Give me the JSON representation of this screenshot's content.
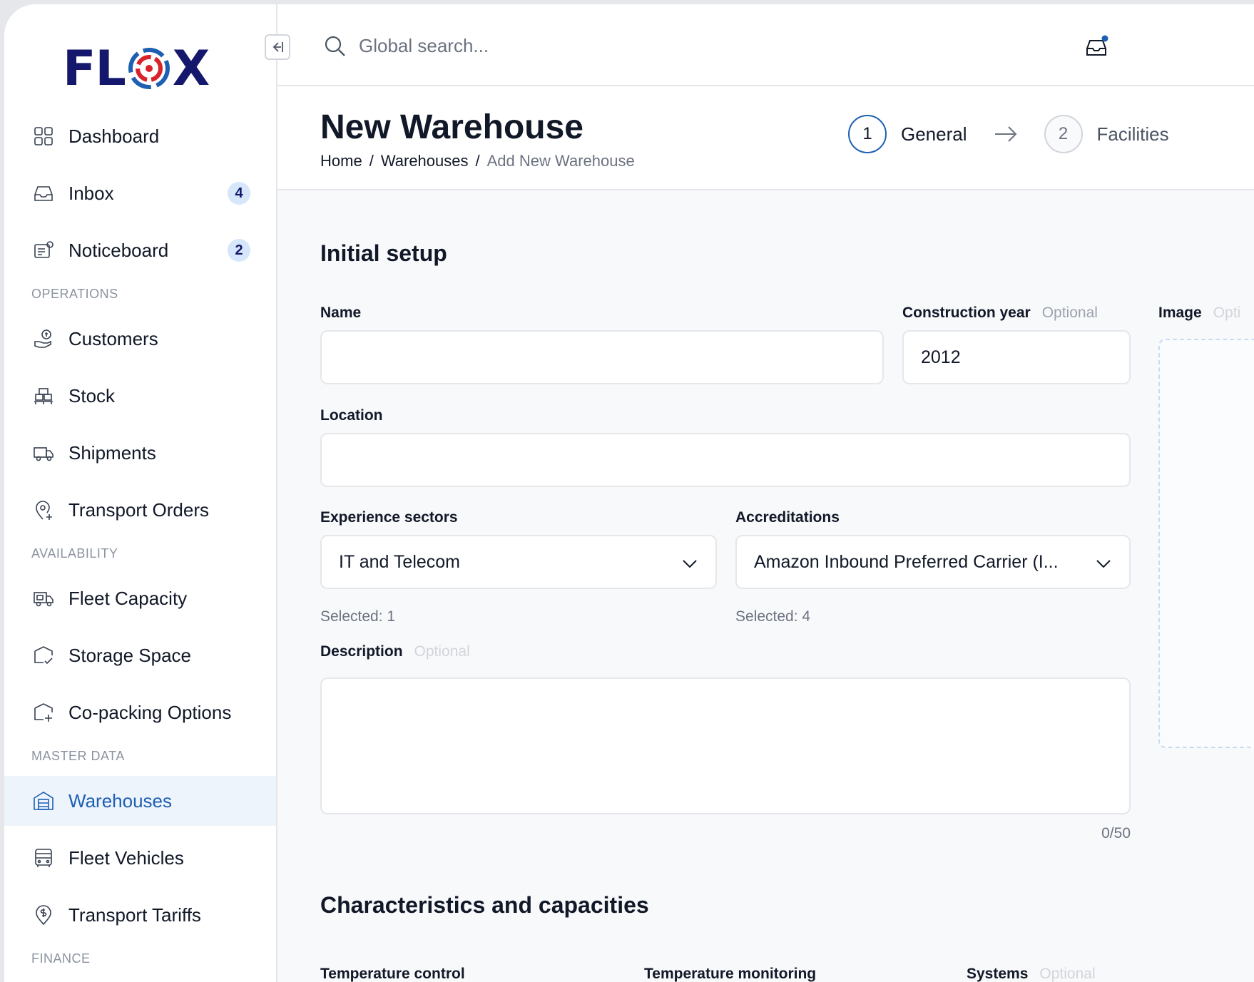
{
  "brand": {
    "logo_text_left": "FL",
    "logo_text_right": "X",
    "accent": "#1d5fb3",
    "navy": "#14176b",
    "logo_ring": "#d8232a"
  },
  "sidebar": {
    "items": [
      {
        "label": "Dashboard",
        "icon": "grid-icon"
      },
      {
        "label": "Inbox",
        "icon": "inbox-icon",
        "badge": "4"
      },
      {
        "label": "Noticeboard",
        "icon": "noticeboard-icon",
        "badge": "2"
      }
    ],
    "sections": [
      {
        "title": "OPERATIONS",
        "items": [
          {
            "label": "Customers",
            "icon": "hand-coin-icon"
          },
          {
            "label": "Stock",
            "icon": "pallet-icon"
          },
          {
            "label": "Shipments",
            "icon": "truck-icon"
          },
          {
            "label": "Transport Orders",
            "icon": "location-pin-plus-icon"
          }
        ]
      },
      {
        "title": "AVAILABILITY",
        "items": [
          {
            "label": "Fleet Capacity",
            "icon": "truck-box-icon"
          },
          {
            "label": "Storage Space",
            "icon": "box-check-icon"
          },
          {
            "label": "Co-packing Options",
            "icon": "box-plus-icon"
          }
        ]
      },
      {
        "title": "MASTER DATA",
        "items": [
          {
            "label": "Warehouses",
            "icon": "warehouse-icon",
            "active": true
          },
          {
            "label": "Fleet Vehicles",
            "icon": "bus-icon"
          },
          {
            "label": "Transport Tariffs",
            "icon": "location-dollar-icon"
          }
        ]
      },
      {
        "title": "FINANCE",
        "items": []
      }
    ]
  },
  "topbar": {
    "search_placeholder": "Global search..."
  },
  "header": {
    "title": "New Warehouse",
    "breadcrumb": [
      "Home",
      "/",
      "Warehouses",
      "/",
      "Add New Warehouse"
    ],
    "steps": [
      {
        "number": "1",
        "label": "General",
        "active": true
      },
      {
        "number": "2",
        "label": "Facilities",
        "active": false
      }
    ]
  },
  "form": {
    "initial_setup_title": "Initial setup",
    "name_label": "Name",
    "name_value": "",
    "construction_label": "Construction year",
    "construction_optional": "Optional",
    "construction_value": "2012",
    "image_label": "Image",
    "image_optional": "Opti",
    "location_label": "Location",
    "location_value": "",
    "sectors_label": "Experience sectors",
    "sectors_value": "IT and Telecom",
    "sectors_helper": "Selected: 1",
    "accreditations_label": "Accreditations",
    "accreditations_value": "Amazon Inbound Preferred Carrier (I...",
    "accreditations_helper": "Selected: 4",
    "description_label": "Description",
    "description_optional": "Optional",
    "description_counter": "0/50",
    "characteristics_title": "Characteristics and capacities",
    "temp_control_label": "Temperature control",
    "temp_monitoring_label": "Temperature monitoring",
    "systems_label": "Systems",
    "systems_optional": "Optional"
  }
}
